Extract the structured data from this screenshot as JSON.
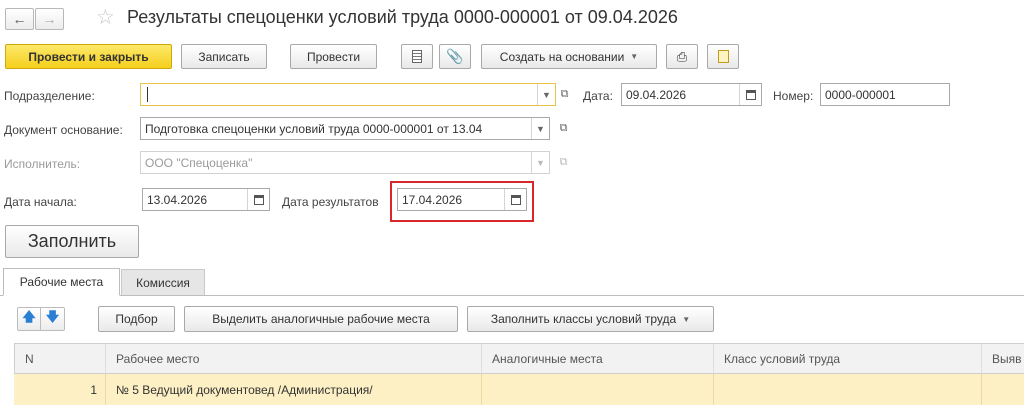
{
  "title": "Результаты спецоценки условий труда 0000-000001 от 09.04.2026",
  "nav": {
    "back_icon": "arrow-left-icon",
    "forward_icon": "arrow-right-icon",
    "favorite_icon": "star-icon"
  },
  "toolbar": {
    "post_and_close": "Провести и закрыть",
    "save": "Записать",
    "post": "Провести",
    "create_based_on": "Создать на основании"
  },
  "form": {
    "subdivision_label": "Подразделение:",
    "subdivision_value": "",
    "date_label": "Дата:",
    "date_value": "09.04.2026",
    "number_label": "Номер:",
    "number_value": "0000-000001",
    "basis_label": "Документ основание:",
    "basis_value": "Подготовка спецоценки условий труда 0000-000001 от 13.04",
    "executor_label": "Исполнитель:",
    "executor_value": "ООО \"Спецоценка\"",
    "start_date_label": "Дата начала:",
    "start_date_value": "13.04.2026",
    "result_date_label": "Дата результатов",
    "result_date_value": "17.04.2026",
    "fill_button": "Заполнить"
  },
  "tabs": [
    {
      "label": "Рабочие места",
      "active": true
    },
    {
      "label": "Комиссия",
      "active": false
    }
  ],
  "table_toolbar": {
    "select": "Подбор",
    "highlight_similar": "Выделить аналогичные рабочие места",
    "fill_classes": "Заполнить классы условий труда"
  },
  "table": {
    "columns": [
      "N",
      "Рабочее место",
      "Аналогичные места",
      "Класс условий труда",
      "Выяв"
    ],
    "rows": [
      {
        "n": "1",
        "workplace": "№ 5 Ведущий документовед /Администрация/",
        "similar": "",
        "class": "",
        "extra": ""
      }
    ]
  },
  "colors": {
    "accent_yellow": "#f5cf1c",
    "highlight_red": "#d9262a",
    "row_selected": "#fdf0c4"
  }
}
